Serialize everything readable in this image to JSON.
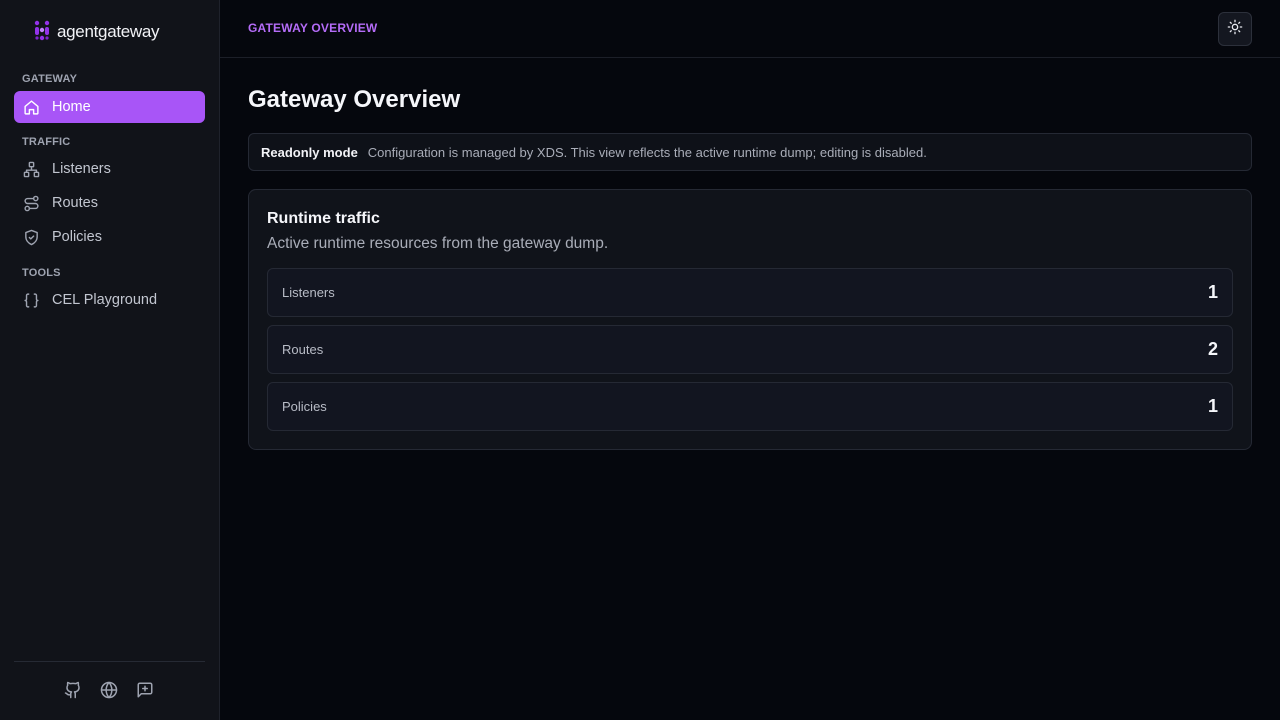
{
  "app": {
    "logo_text": "agentgateway"
  },
  "sidebar": {
    "sections": [
      {
        "label": "GATEWAY"
      },
      {
        "label": "TRAFFIC"
      },
      {
        "label": "TOOLS"
      }
    ],
    "items": [
      {
        "label": "Home",
        "icon": "home-icon",
        "active": true
      },
      {
        "label": "Listeners",
        "icon": "network-icon",
        "active": false
      },
      {
        "label": "Routes",
        "icon": "route-icon",
        "active": false
      },
      {
        "label": "Policies",
        "icon": "shield-check-icon",
        "active": false
      },
      {
        "label": "CEL Playground",
        "icon": "braces-icon",
        "active": false
      }
    ],
    "footer_icons": [
      "github-icon",
      "globe-icon",
      "feedback-icon"
    ]
  },
  "header": {
    "breadcrumb": "GATEWAY OVERVIEW",
    "theme_toggle_icon": "sun-icon"
  },
  "main": {
    "title": "Gateway Overview",
    "notice": {
      "title": "Readonly mode",
      "text": "Configuration is managed by XDS. This view reflects the active runtime dump; editing is disabled."
    },
    "card": {
      "title": "Runtime traffic",
      "subtitle": "Active runtime resources from the gateway dump.",
      "stats": [
        {
          "label": "Listeners",
          "value": "1"
        },
        {
          "label": "Routes",
          "value": "2"
        },
        {
          "label": "Policies",
          "value": "1"
        }
      ]
    }
  },
  "colors": {
    "accent": "#a855f7",
    "background": "#05070d",
    "sidebar": "#111319"
  }
}
